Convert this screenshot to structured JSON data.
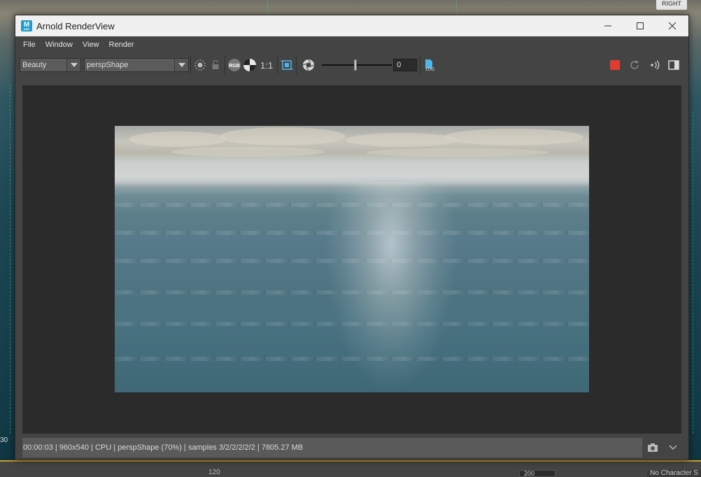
{
  "window": {
    "title": "Arnold RenderView",
    "app_icon_letter": "M",
    "app_icon_sub": "ARD"
  },
  "menu": {
    "items": [
      "File",
      "Window",
      "View",
      "Render"
    ]
  },
  "toolbar": {
    "aov_value": "Beauty",
    "camera_value": "perspShape",
    "ratio_label": "1:1",
    "rgb_label": "RGB",
    "exposure_value": "0",
    "exposure_fraction": 0.5,
    "log_label": "LOG"
  },
  "status": {
    "text": "00:00:03 | 960x540 | CPU | perspShape (70%) | samples 3/2/2/2/2/2 | 7805.27 MB"
  },
  "background": {
    "corner_label": "RIGHT",
    "left_number": "30",
    "timeline_left": "120",
    "timeline_right": "200",
    "character_set": "No Character S"
  },
  "colors": {
    "stop_button": "#e03c31",
    "app_icon": "#1f9bd1",
    "timeline_accent": "#c9a227"
  },
  "icons": {
    "snapshot": "camera-icon",
    "expand": "chevron-down-icon"
  }
}
